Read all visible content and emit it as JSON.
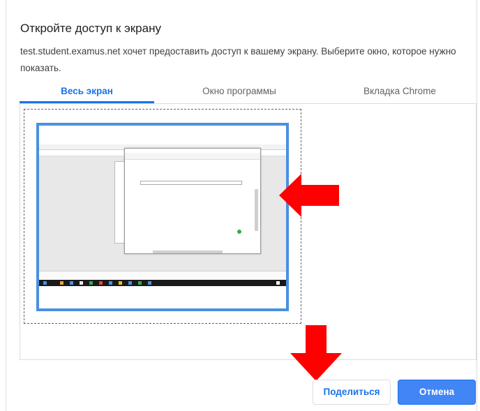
{
  "dialog": {
    "title": "Откройте доступ к экрану",
    "description": "test.student.examus.net хочет предоставить доступ к вашему экрану. Выберите окно, которое нужно показать."
  },
  "tabs": [
    {
      "label": "Весь экран",
      "active": true
    },
    {
      "label": "Окно программы",
      "active": false
    },
    {
      "label": "Вкладка Chrome",
      "active": false
    }
  ],
  "buttons": {
    "share_label": "Поделиться",
    "cancel_label": "Отмена"
  },
  "colors": {
    "accent": "#1a73e8",
    "primary_button": "#4285f4",
    "selection_border": "#4a90e2",
    "annotation_arrow": "#ff0000"
  },
  "icons": {
    "annotation_right": "arrow-right-icon",
    "annotation_down": "arrow-down-icon"
  }
}
